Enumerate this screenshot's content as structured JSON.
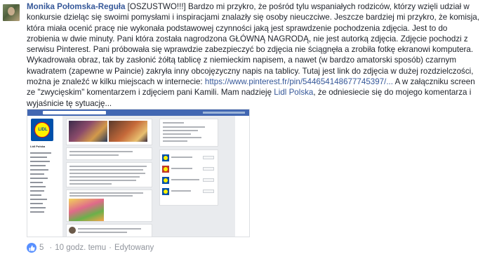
{
  "comment": {
    "author": "Monika Połomska-Reguła",
    "text_before_link": " [OSZUSTWO!!!] Bardzo mi przykro, że pośród tylu wspaniałych rodziców, którzy wzięli udział w konkursie dzieląc się swoimi pomysłami i inspiracjami znalazły się osoby nieuczciwe. Jeszcze bardziej mi przykro, że komisja, która miała ocenić pracę nie wykonała podstawowej czynności jaką jest sprawdzenie pochodzenia zdjęcia. Jest to do zrobienia w dwie minuty. Pani która została nagrodzona GŁÓWNĄ NAGRODĄ, nie jest autorką zdjęcia. Zdjęcie pochodzi z serwisu Pinterest. Pani próbowała się wprawdzie zabezpieczyć bo zdjęcia nie ściągnęła a zrobiła fotkę ekranowi komputera. Wykadrowała obraz, tak by zasłonić żółtą tablicę z niemieckim napisem, a nawet (w bardzo amatorski sposób) czarnym kwadratem (zapewne w Paincie) zakryła inny obcojęzyczny napis na tablicy. Tutaj jest link do zdjęcia w dużej rozdzielczości, można je znaleźć w kilku miejscach w internecie: ",
    "link_url": "https://www.pinterest.fr/pin/544654148677745397/...",
    "text_middle": " A w załączniku screen ze \"zwycięskim\" komentarzem i zdjęciem pani Kamili. Mam nadzieję ",
    "mention": "Lidl Polska",
    "text_end": ", że odniesiecie się do mojego komentarza i wyjaśnicie tę sytuację..."
  },
  "attachment": {
    "page_name": "Lidl Polska",
    "lidl_logo_text": "LIDL",
    "brand_blue": "#0050aa",
    "brand_yellow": "#fff200",
    "fb_blue": "#4267b2"
  },
  "footer": {
    "likes_count": "5",
    "separator": "·",
    "time": "10 godz. temu",
    "edited": "Edytowany",
    "like_icon": "thumbs-up-icon",
    "like_color": "#5890ff"
  }
}
